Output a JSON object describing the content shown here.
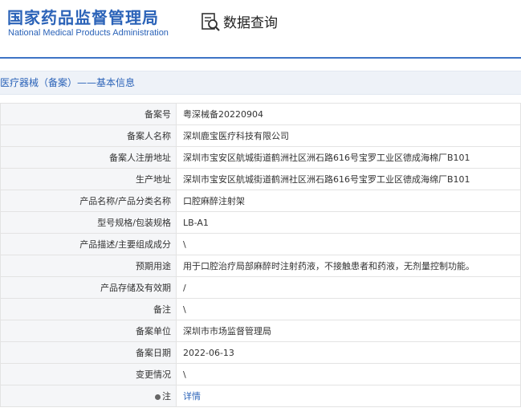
{
  "header": {
    "logo_cn": "国家药品监督管理局",
    "logo_en": "National Medical Products Administration",
    "query_title": "数据查询",
    "icon": "search-document-icon"
  },
  "section": {
    "title": "医疗器械（备案）——基本信息"
  },
  "rows": [
    {
      "label": "备案号",
      "value": "粤深械备20220904"
    },
    {
      "label": "备案人名称",
      "value": "深圳鹿宝医疗科技有限公司"
    },
    {
      "label": "备案人注册地址",
      "value": "深圳市宝安区航城街道鹤洲社区洲石路616号宝罗工业区德成海棉厂B101"
    },
    {
      "label": "生产地址",
      "value": "深圳市宝安区航城街道鹤洲社区洲石路616号宝罗工业区德成海绵厂B101"
    },
    {
      "label": "产品名称/产品分类名称",
      "value": "口腔麻醉注射架"
    },
    {
      "label": "型号规格/包装规格",
      "value": "LB-A1"
    },
    {
      "label": "产品描述/主要组成成分",
      "value": "\\"
    },
    {
      "label": "预期用途",
      "value": "用于口腔治疗局部麻醉时注射药液，不接触患者和药液，无剂量控制功能。"
    },
    {
      "label": "产品存储及有效期",
      "value": "/"
    },
    {
      "label": "备注",
      "value": "\\"
    },
    {
      "label": "备案单位",
      "value": "深圳市市场监督管理局"
    },
    {
      "label": "备案日期",
      "value": "2022-06-13"
    },
    {
      "label": "变更情况",
      "value": "\\"
    },
    {
      "label": "注",
      "value": "详情"
    }
  ],
  "colors": {
    "brand": "#2b63b8",
    "line": "#3e74c5"
  }
}
